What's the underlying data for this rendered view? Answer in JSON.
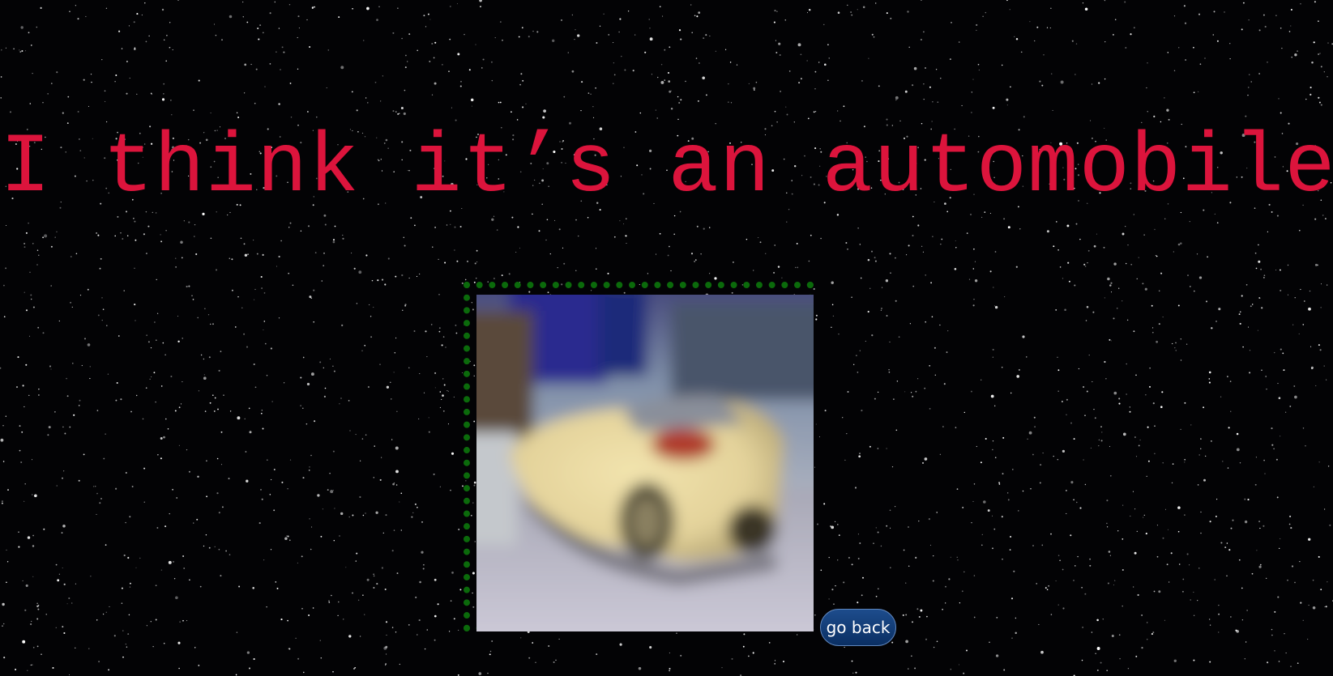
{
  "result": {
    "headline": "I think it’s an automobile.",
    "image_subject": "yellow car"
  },
  "navigation": {
    "back_label": "go back"
  },
  "colors": {
    "background": "#000000",
    "headline": "#dc143c",
    "frame_border": "#0b6a0b",
    "button_bg": "#0a2f63",
    "button_text": "#ffffff"
  },
  "icons": {
    "background": "starfield",
    "frame_style": "dotted-border"
  }
}
